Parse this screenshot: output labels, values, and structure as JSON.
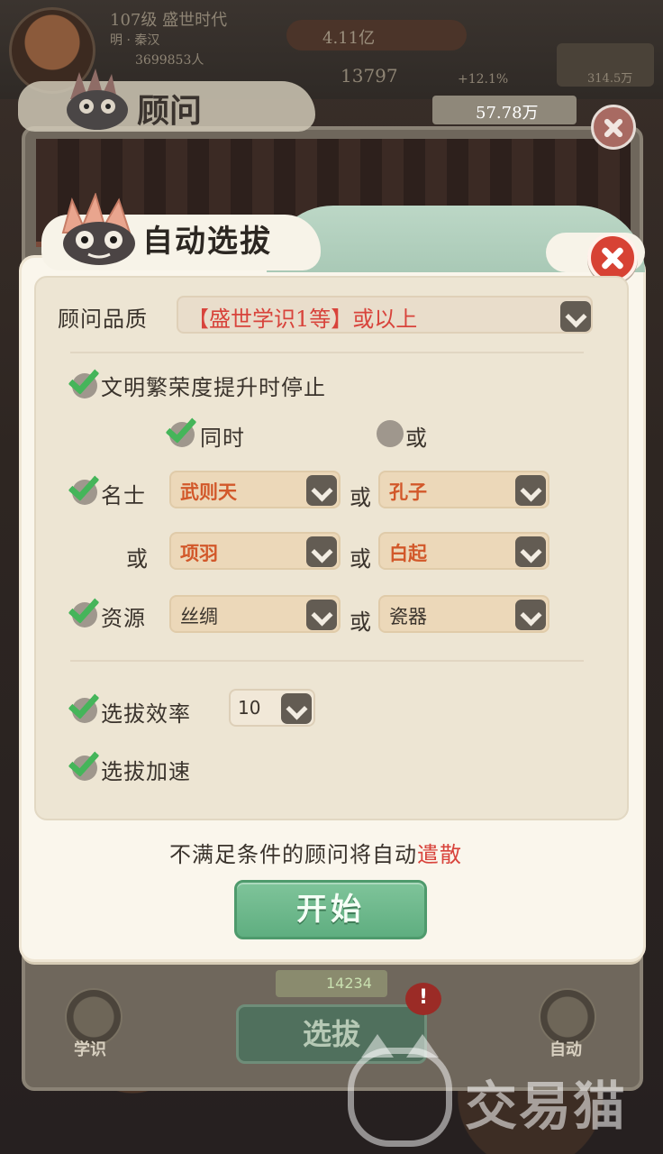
{
  "hud": {
    "level_text": "107级 盛世时代",
    "sub_text": "明 · 秦汉",
    "population": "3699853人",
    "wealth": "4.11亿",
    "stat_number": "13797",
    "stat_plus": "+12.1%",
    "right_stat": "314.5万"
  },
  "back_panel": {
    "title": "顾问",
    "resource_value": "57.78万",
    "bottom_count": "14234",
    "select_button": "选拔",
    "alert_badge": "!",
    "left_button_label": "学识",
    "right_button_label": "自动"
  },
  "dialog": {
    "title": "自动选拔",
    "quality_label": "顾问品质",
    "quality_value": "【盛世学识1等】或以上",
    "stop_on_rise_label": "文明繁荣度提升时停止",
    "mode_and_label": "同时",
    "mode_or_label": "或",
    "famous_label": "名士",
    "resource_label": "资源",
    "or_word": "或",
    "famous": {
      "slot1": "武则天",
      "slot2": "孔子",
      "slot3": "项羽",
      "slot4": "白起"
    },
    "resource": {
      "slot1": "丝绸",
      "slot2": "瓷器"
    },
    "efficiency_label": "选拔效率",
    "efficiency_value": "10",
    "accelerate_label": "选拔加速",
    "notice_prefix": "不满足条件的顾问将自动",
    "notice_emphasis": "遣散",
    "start_button": "开始"
  },
  "watermark": {
    "text": "交易猫"
  },
  "icons": {
    "close": "close-icon",
    "dropdown": "chevron-down-icon",
    "check": "checkmark-icon",
    "radio": "radio-icon"
  },
  "colors": {
    "accent_red": "#d8433b",
    "check_green": "#45b55a",
    "start_green": "#5fae80",
    "name_orange": "#d2582a"
  }
}
